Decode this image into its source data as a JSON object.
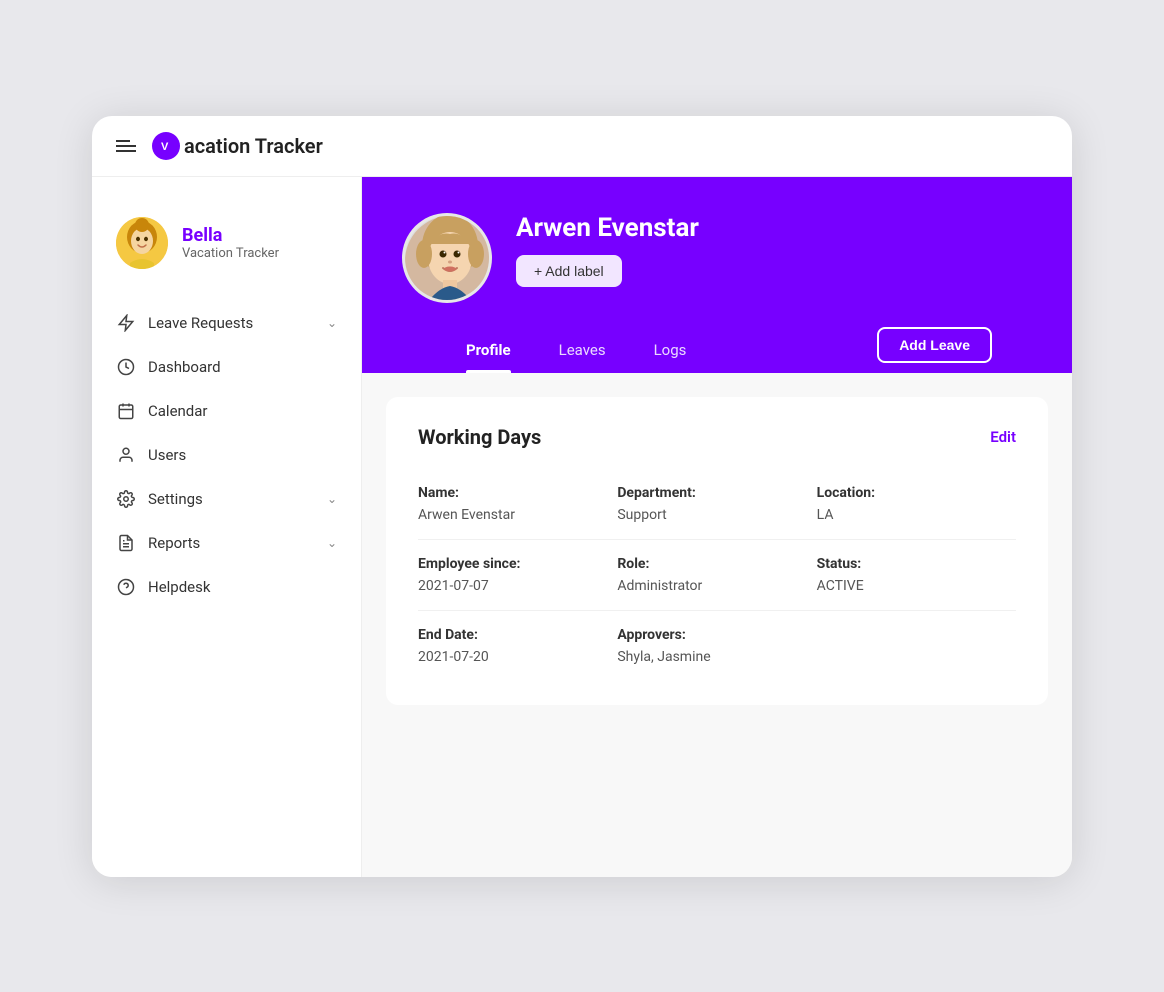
{
  "app": {
    "logo_text": "acation Tracker",
    "logo_letter": "V"
  },
  "sidebar": {
    "profile": {
      "name": "Bella",
      "subtitle": "Vacation Tracker"
    },
    "nav_items": [
      {
        "id": "leave-requests",
        "label": "Leave Requests",
        "has_chevron": true,
        "icon": "lightning"
      },
      {
        "id": "dashboard",
        "label": "Dashboard",
        "has_chevron": false,
        "icon": "dashboard"
      },
      {
        "id": "calendar",
        "label": "Calendar",
        "has_chevron": false,
        "icon": "calendar"
      },
      {
        "id": "users",
        "label": "Users",
        "has_chevron": false,
        "icon": "user"
      },
      {
        "id": "settings",
        "label": "Settings",
        "has_chevron": true,
        "icon": "settings"
      },
      {
        "id": "reports",
        "label": "Reports",
        "has_chevron": true,
        "icon": "reports"
      },
      {
        "id": "helpdesk",
        "label": "Helpdesk",
        "has_chevron": false,
        "icon": "help"
      }
    ]
  },
  "profile_header": {
    "name": "Arwen Evenstar",
    "add_label_btn": "+ Add label"
  },
  "tabs": [
    {
      "id": "profile",
      "label": "Profile",
      "active": true
    },
    {
      "id": "leaves",
      "label": "Leaves",
      "active": false
    },
    {
      "id": "logs",
      "label": "Logs",
      "active": false
    }
  ],
  "add_leave_btn": "Add Leave",
  "working_days": {
    "title": "Working Days",
    "edit_label": "Edit",
    "fields": [
      {
        "label": "Name:",
        "value": "Arwen Evenstar",
        "col": 1,
        "row": 1
      },
      {
        "label": "Department:",
        "value": "Support",
        "col": 2,
        "row": 1
      },
      {
        "label": "Location:",
        "value": "LA",
        "col": 3,
        "row": 1
      },
      {
        "label": "Employee since:",
        "value": "2021-07-07",
        "col": 1,
        "row": 2
      },
      {
        "label": "Role:",
        "value": "Administrator",
        "col": 2,
        "row": 2
      },
      {
        "label": "Status:",
        "value": "ACTIVE",
        "col": 3,
        "row": 2
      },
      {
        "label": "End Date:",
        "value": "2021-07-20",
        "col": 1,
        "row": 3
      },
      {
        "label": "Approvers:",
        "value": "Shyla, Jasmine",
        "col": 2,
        "row": 3
      }
    ]
  },
  "colors": {
    "primary": "#7700ff",
    "text_dark": "#222",
    "text_mid": "#555",
    "text_light": "#888"
  }
}
